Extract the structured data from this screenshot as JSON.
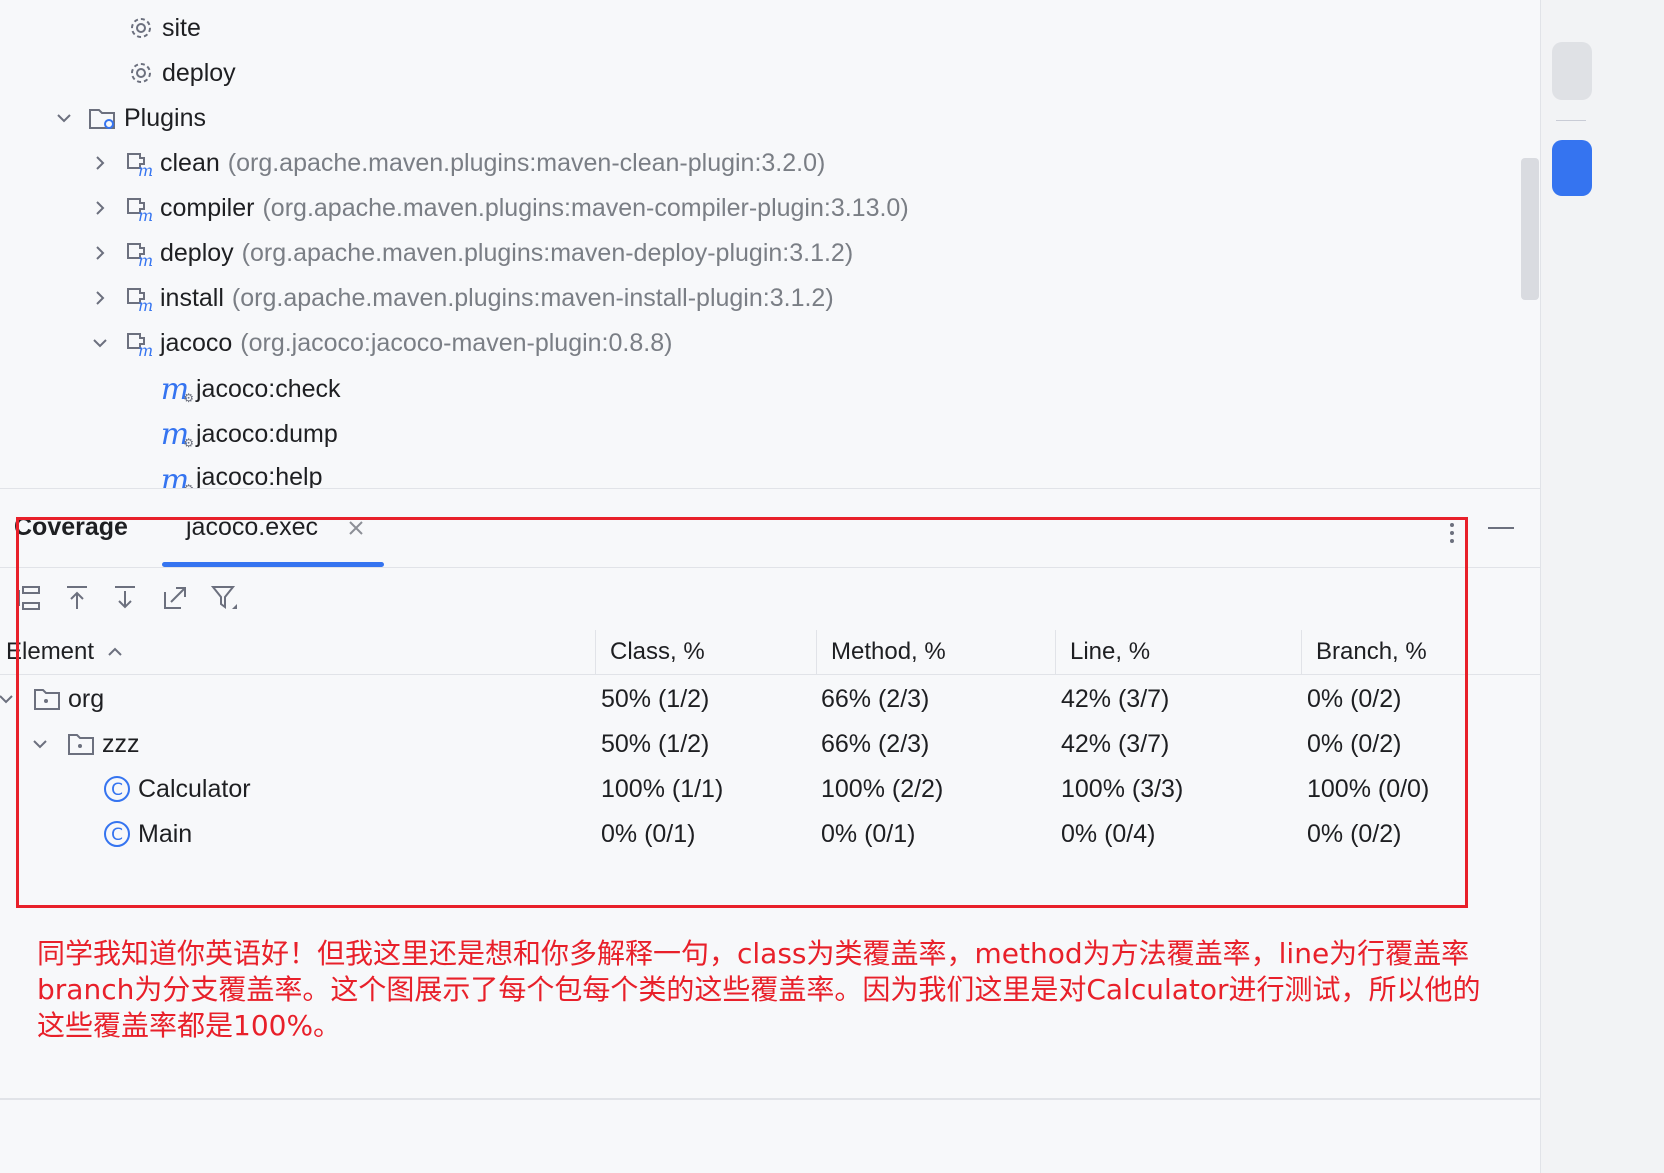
{
  "tree": {
    "items": [
      {
        "label": "site",
        "extra": ""
      },
      {
        "label": "deploy",
        "extra": ""
      },
      {
        "label": "Plugins",
        "extra": ""
      },
      {
        "label": "clean",
        "extra": "(org.apache.maven.plugins:maven-clean-plugin:3.2.0)"
      },
      {
        "label": "compiler",
        "extra": "(org.apache.maven.plugins:maven-compiler-plugin:3.13.0)"
      },
      {
        "label": "deploy",
        "extra": "(org.apache.maven.plugins:maven-deploy-plugin:3.1.2)"
      },
      {
        "label": "install",
        "extra": "(org.apache.maven.plugins:maven-install-plugin:3.1.2)"
      },
      {
        "label": "jacoco",
        "extra": "(org.jacoco:jacoco-maven-plugin:0.8.8)"
      },
      {
        "label": "jacoco:check",
        "extra": ""
      },
      {
        "label": "jacoco:dump",
        "extra": ""
      },
      {
        "label": "jacoco:help",
        "extra": ""
      }
    ]
  },
  "coverage": {
    "title": "Coverage",
    "tab_label": "jacoco.exec",
    "columns": [
      "Element",
      "Class, %",
      "Method, %",
      "Line, %",
      "Branch, %"
    ],
    "rows": [
      {
        "name": "org",
        "class": "50% (1/2)",
        "method": "66% (2/3)",
        "line": "42% (3/7)",
        "branch": "0% (0/2)"
      },
      {
        "name": "zzz",
        "class": "50% (1/2)",
        "method": "66% (2/3)",
        "line": "42% (3/7)",
        "branch": "0% (0/2)"
      },
      {
        "name": "Calculator",
        "class": "100% (1/1)",
        "method": "100% (2/2)",
        "line": "100% (3/3)",
        "branch": "100% (0/0)"
      },
      {
        "name": "Main",
        "class": "0% (0/1)",
        "method": "0% (0/1)",
        "line": "0% (0/4)",
        "branch": "0% (0/2)"
      }
    ]
  },
  "annotation": {
    "text": "同学我知道你英语好！但我这里还是想和你多解释一句，class为类覆盖率，method为方法覆盖率，line为行覆盖率branch为分支覆盖率。这个图展示了每个包每个类的这些覆盖率。因为我们这里是对Calculator进行测试，所以他的这些覆盖率都是100%。"
  },
  "colors": {
    "accent": "#3574f0",
    "annotation": "#e8202a"
  }
}
